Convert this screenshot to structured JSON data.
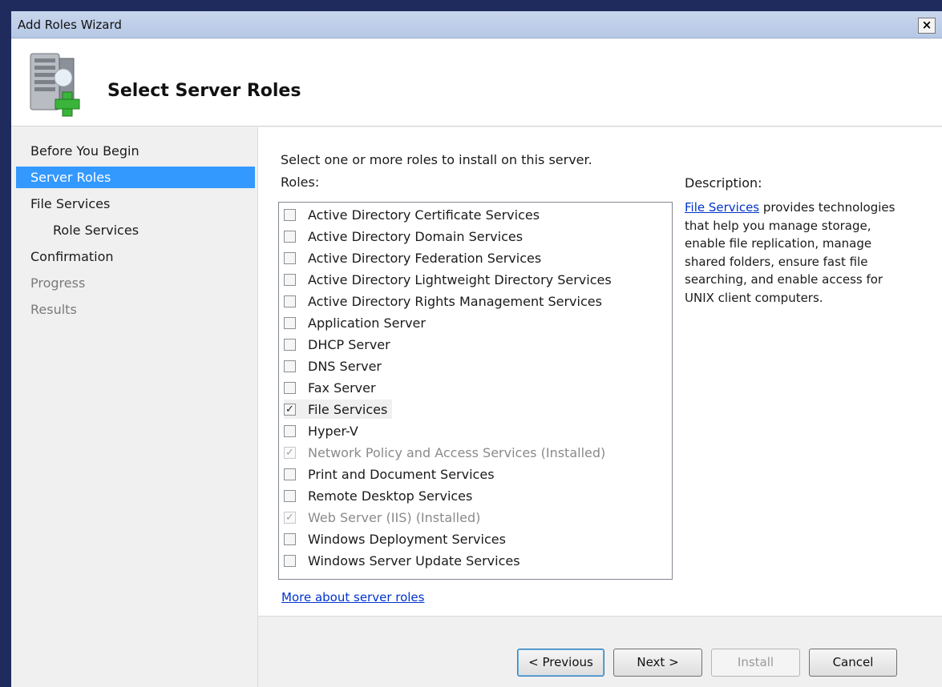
{
  "window": {
    "title": "Add Roles Wizard",
    "close_label": "×"
  },
  "header": {
    "icon": "server-add-icon",
    "title": "Select Server Roles"
  },
  "nav": {
    "items": [
      {
        "label": "Before You Begin",
        "state": "normal"
      },
      {
        "label": "Server Roles",
        "state": "active"
      },
      {
        "label": "File Services",
        "state": "normal"
      },
      {
        "label": "Role Services",
        "state": "sub"
      },
      {
        "label": "Confirmation",
        "state": "normal"
      },
      {
        "label": "Progress",
        "state": "disabled"
      },
      {
        "label": "Results",
        "state": "disabled"
      }
    ]
  },
  "main": {
    "instruction": "Select one or more roles to install on this server.",
    "roles_label": "Roles:",
    "roles": [
      {
        "label": "Active Directory Certificate Services",
        "checked": false,
        "installed": false
      },
      {
        "label": "Active Directory Domain Services",
        "checked": false,
        "installed": false
      },
      {
        "label": "Active Directory Federation Services",
        "checked": false,
        "installed": false
      },
      {
        "label": "Active Directory Lightweight Directory Services",
        "checked": false,
        "installed": false
      },
      {
        "label": "Active Directory Rights Management Services",
        "checked": false,
        "installed": false
      },
      {
        "label": "Application Server",
        "checked": false,
        "installed": false
      },
      {
        "label": "DHCP Server",
        "checked": false,
        "installed": false
      },
      {
        "label": "DNS Server",
        "checked": false,
        "installed": false
      },
      {
        "label": "Fax Server",
        "checked": false,
        "installed": false
      },
      {
        "label": "File Services",
        "checked": true,
        "installed": false,
        "selected": true
      },
      {
        "label": "Hyper-V",
        "checked": false,
        "installed": false
      },
      {
        "label": "Network Policy and Access Services  (Installed)",
        "checked": true,
        "installed": true
      },
      {
        "label": "Print and Document Services",
        "checked": false,
        "installed": false
      },
      {
        "label": "Remote Desktop Services",
        "checked": false,
        "installed": false
      },
      {
        "label": "Web Server (IIS)  (Installed)",
        "checked": true,
        "installed": true
      },
      {
        "label": "Windows Deployment Services",
        "checked": false,
        "installed": false
      },
      {
        "label": "Windows Server Update Services",
        "checked": false,
        "installed": false
      }
    ],
    "more_link": "More about server roles",
    "description": {
      "label": "Description:",
      "link": "File Services",
      "text": " provides technologies that help you manage storage, enable file replication, manage shared folders, ensure fast file searching, and enable access for UNIX client computers."
    }
  },
  "footer": {
    "previous": "< Previous",
    "next": "Next >",
    "install": "Install",
    "cancel": "Cancel"
  },
  "colors": {
    "desktop": "#1f2b5c",
    "selection": "#3399ff",
    "link": "#0033cc"
  }
}
